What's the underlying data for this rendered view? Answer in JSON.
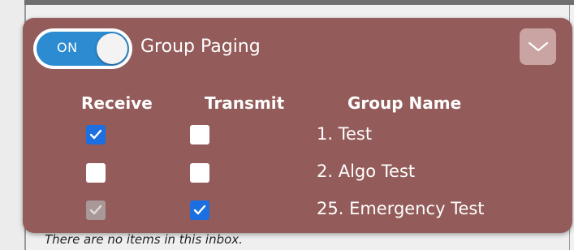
{
  "toggle": {
    "label": "ON",
    "state": true,
    "color": "#2c8bd1"
  },
  "panel": {
    "title": "Group Paging",
    "background": "#935b59",
    "collapse_icon": "chevron-down-icon"
  },
  "table": {
    "headers": {
      "receive": "Receive",
      "transmit": "Transmit",
      "group_name": "Group Name"
    },
    "rows": [
      {
        "receive": true,
        "transmit": false,
        "name": "1. Test",
        "receive_disabled": false
      },
      {
        "receive": false,
        "transmit": false,
        "name": "2. Algo Test",
        "receive_disabled": false
      },
      {
        "receive": true,
        "transmit": true,
        "name": "25. Emergency Test",
        "receive_disabled": true
      }
    ]
  },
  "background": {
    "inbox_empty_text": "There are no items in this inbox."
  }
}
